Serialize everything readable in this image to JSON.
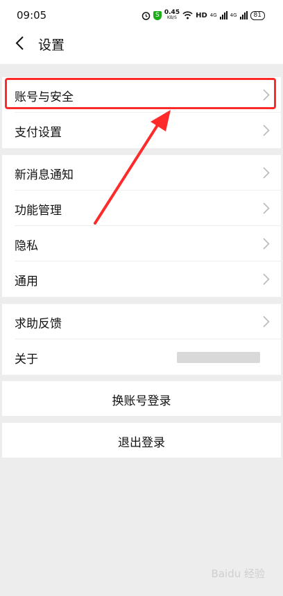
{
  "status_bar": {
    "time": "09:05",
    "speed_value": "0.45",
    "speed_unit": "KB/S",
    "hd_label": "HD",
    "net1": "4G",
    "net2": "4G",
    "battery": "81"
  },
  "header": {
    "title": "设置"
  },
  "groups": [
    {
      "items": [
        {
          "label": "账号与安全"
        },
        {
          "label": "支付设置"
        }
      ]
    },
    {
      "items": [
        {
          "label": "新消息通知"
        },
        {
          "label": "功能管理"
        },
        {
          "label": "隐私"
        },
        {
          "label": "通用"
        }
      ]
    },
    {
      "items": [
        {
          "label": "求助反馈"
        },
        {
          "label": "关于"
        }
      ]
    }
  ],
  "actions": {
    "switch_account": "换账号登录",
    "logout": "退出登录"
  },
  "annotation": {
    "highlight_color": "#ff2a2a",
    "target": "账号与安全"
  },
  "watermark": "Baidu 经验",
  "icons": [
    "back-icon",
    "chevron-right-icon",
    "alarm-icon",
    "shield-icon",
    "wifi-icon",
    "signal-icon",
    "battery-icon"
  ]
}
